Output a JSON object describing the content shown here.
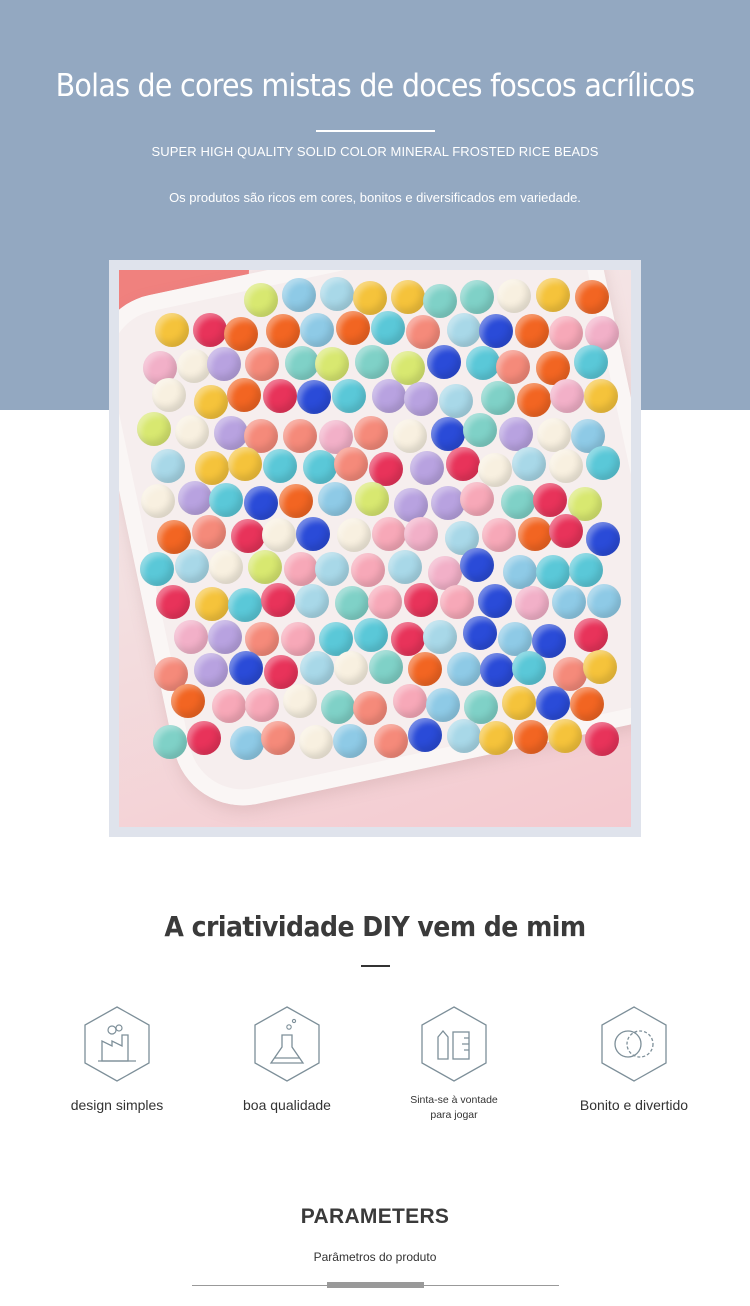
{
  "hero": {
    "title": "Bolas de cores mistas de doces foscos acrílicos",
    "subtitle": "SUPER HIGH QUALITY SOLID COLOR MINERAL FROSTED RICE BEADS",
    "description": "Os produtos são ricos em cores, bonitos e diversificados em variedade.",
    "background_color": "#93a8c1"
  },
  "photo": {
    "bead_colors": [
      "#5ac8d8",
      "#f7a8b8",
      "#f5c33b",
      "#f26522",
      "#e8335a",
      "#b8a2e0",
      "#a8d8e8",
      "#f8f0e0",
      "#d8e870",
      "#f58a7a",
      "#8ecae6",
      "#2a4bd8",
      "#f2b0c8",
      "#7fd1c7"
    ]
  },
  "section": {
    "title": "A criatividade DIY vem de mim"
  },
  "features": [
    {
      "label": "design simples",
      "icon": "factory-icon"
    },
    {
      "label": "boa qualidade",
      "icon": "flask-icon"
    },
    {
      "label": "Sinta-se à vontade para jogar",
      "icon": "ruler-pencil-icon"
    },
    {
      "label": "Bonito e divertido",
      "icon": "rings-icon"
    }
  ],
  "parameters": {
    "title": "PARAMETERS",
    "subtitle": "Parâmetros do produto"
  }
}
